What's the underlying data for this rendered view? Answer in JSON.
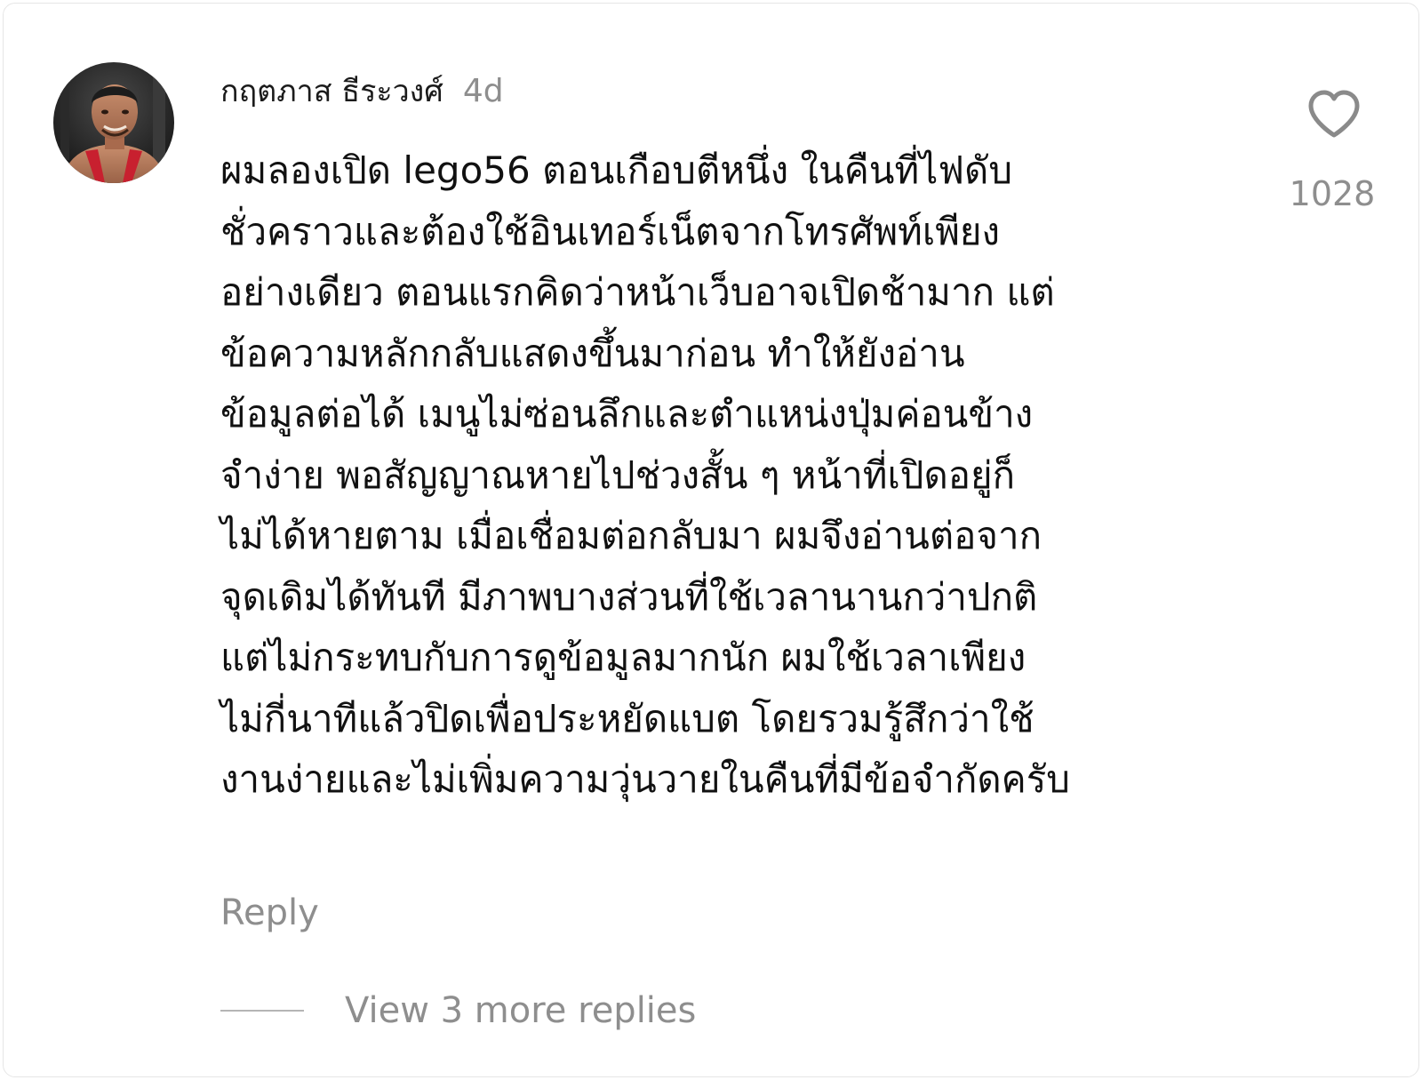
{
  "comment": {
    "username": "กฤตภาส ธีระวงศ์",
    "timestamp": "4d",
    "avatar_icon": "user-avatar-photo",
    "body_lines": [
      "ผมลองเปิด lego56 ตอนเกือบตีหนึ่ง ในคืนที่ไฟดับ",
      "ชั่วคราวและต้องใช้อินเทอร์เน็ตจากโทรศัพท์เพียง",
      "อย่างเดียว ตอนแรกคิดว่าหน้าเว็บอาจเปิดช้ามาก แต่",
      "ข้อความหลักกลับแสดงขึ้นมาก่อน ทำให้ยังอ่าน",
      "ข้อมูลต่อได้ เมนูไม่ซ่อนลึกและตำแหน่งปุ่มค่อนข้าง",
      "จำง่าย พอสัญญาณหายไปช่วงสั้น ๆ หน้าที่เปิดอยู่ก็",
      "ไม่ได้หายตาม เมื่อเชื่อมต่อกลับมา ผมจึงอ่านต่อจาก",
      "จุดเดิมได้ทันที มีภาพบางส่วนที่ใช้เวลานานกว่าปกติ",
      "แต่ไม่กระทบกับการดูข้อมูลมากนัก ผมใช้เวลาเพียง",
      "ไม่กี่นาทีแล้วปิดเพื่อประหยัดแบต โดยรวมรู้สึกว่าใช้",
      "งานง่ายและไม่เพิ่มความวุ่นวายในคืนที่มีข้อจำกัดครับ"
    ],
    "like_icon": "heart-outline-icon",
    "like_count": "1028",
    "reply_label": "Reply",
    "view_replies_label": "View 3 more replies"
  },
  "colors": {
    "text_primary": "#111111",
    "text_secondary": "#8e8e8e",
    "avatar_accent": "#c8202f"
  }
}
